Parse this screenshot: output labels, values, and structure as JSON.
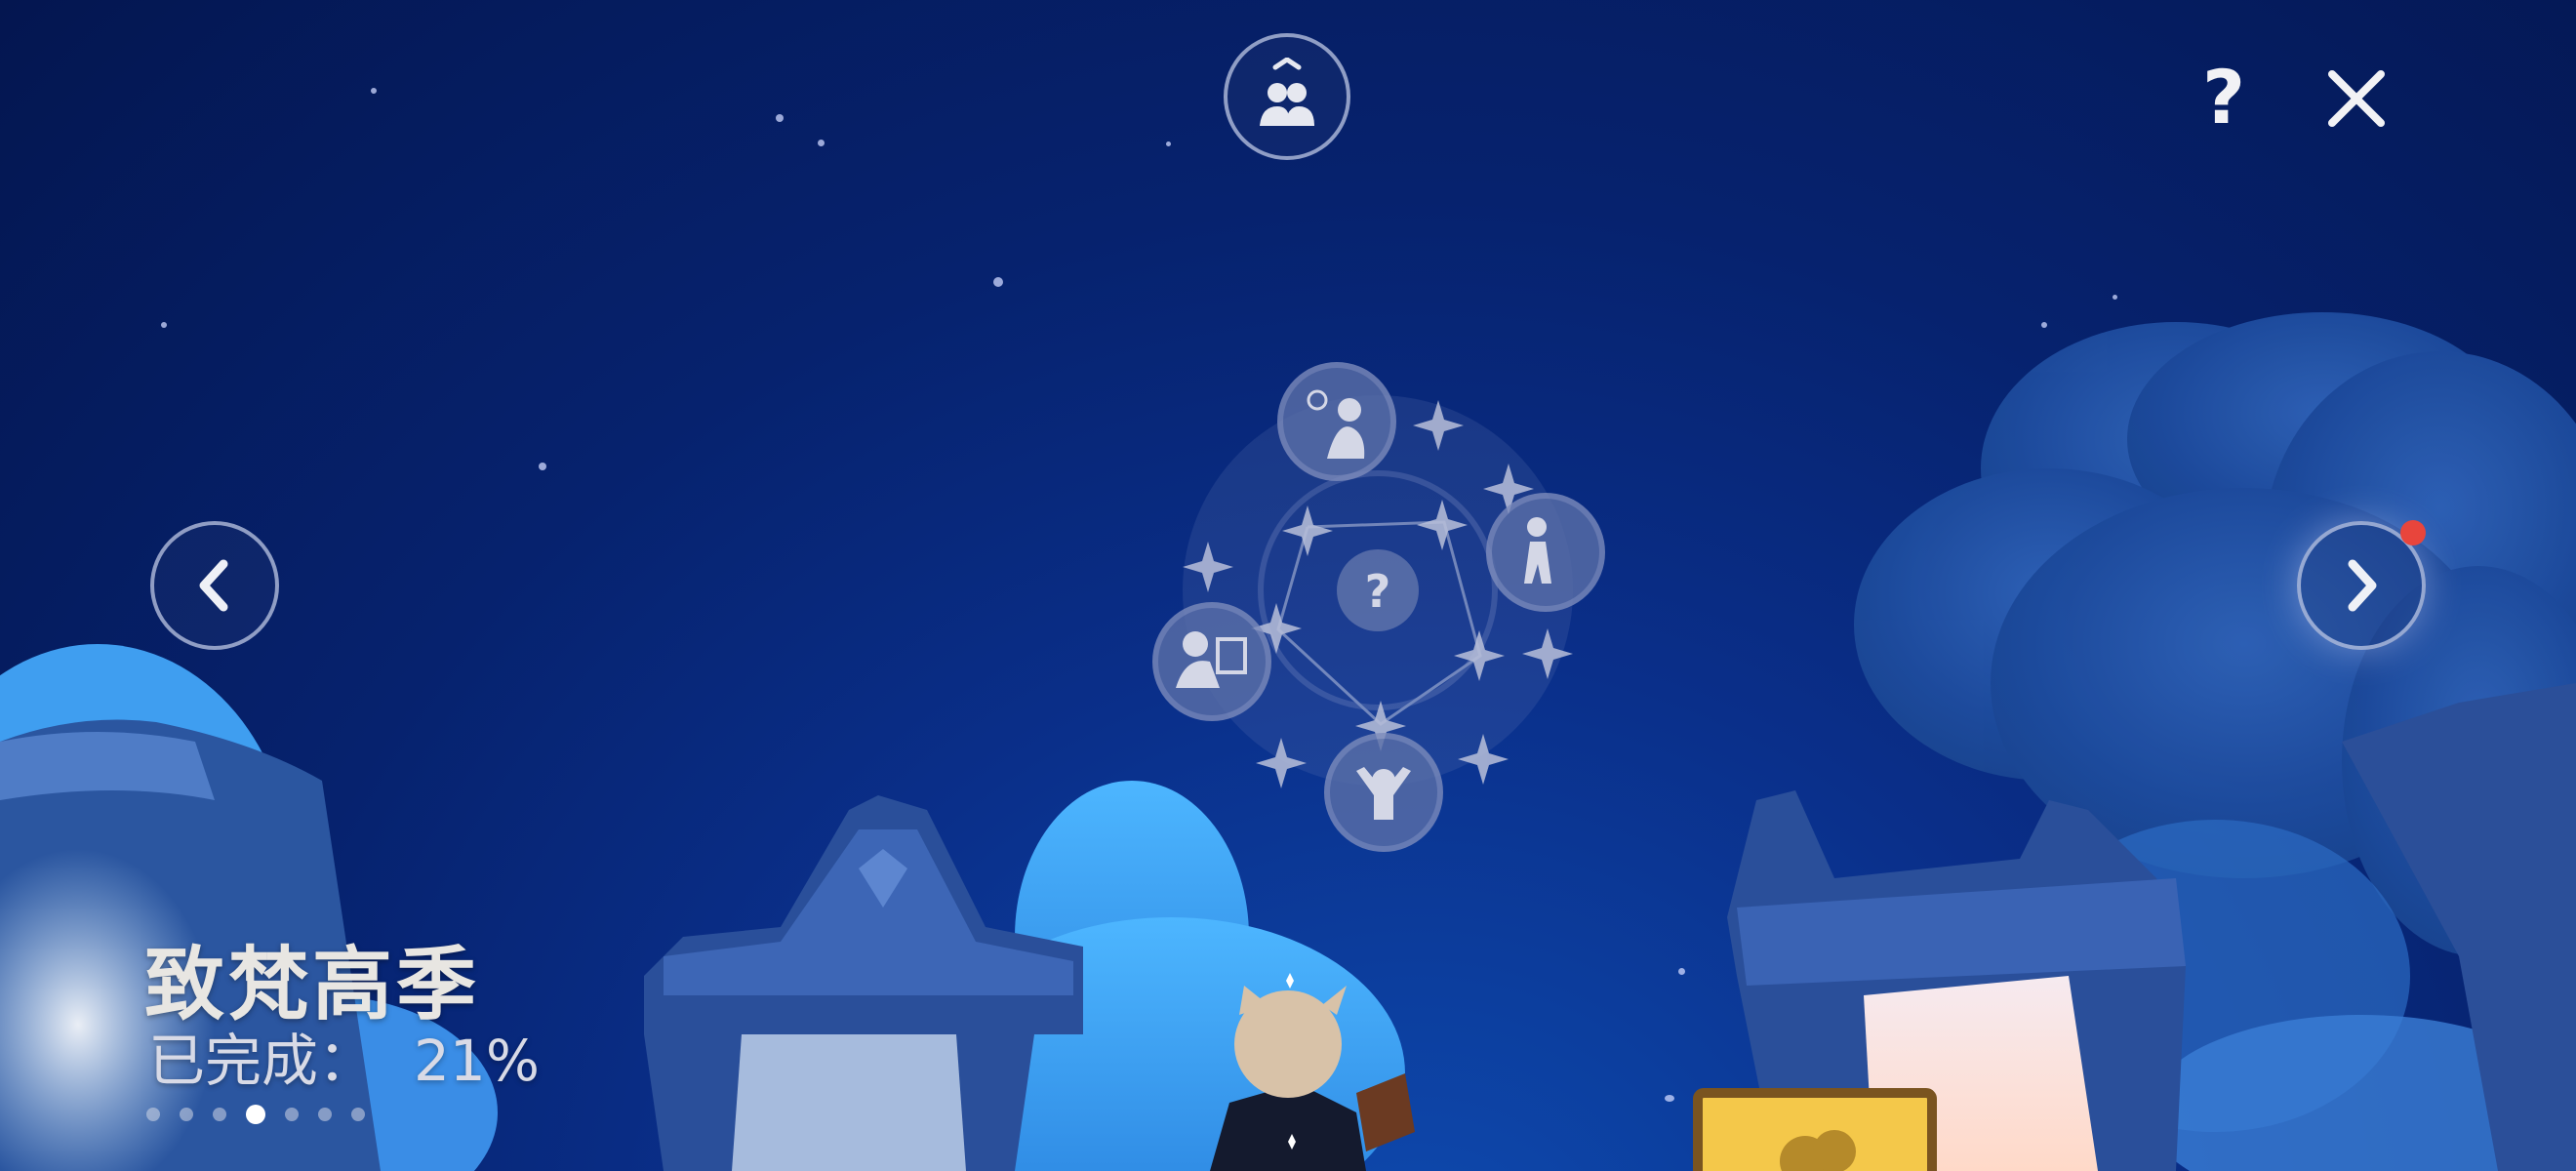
{
  "season": {
    "title": "致梵高季",
    "progress_label": "已完成：",
    "progress_value": "21%",
    "progress_fraction": 0.21
  },
  "pagination": {
    "count": 7,
    "active_index": 3
  },
  "buttons": {
    "help_icon": "question-mark",
    "close_icon": "x",
    "friends_icon": "two-people",
    "prev_icon": "chevron-left",
    "next_icon": "chevron-right",
    "next_has_notification": true
  },
  "constellation": {
    "center_icon": "question-mark",
    "nodes": [
      "thinking-spirit",
      "walking-spirit",
      "painting-spirit",
      "cheering-spirit"
    ]
  },
  "colors": {
    "notification": "#e8453c",
    "sky_top": "#041650",
    "sky_bottom": "#0e4bb0"
  }
}
